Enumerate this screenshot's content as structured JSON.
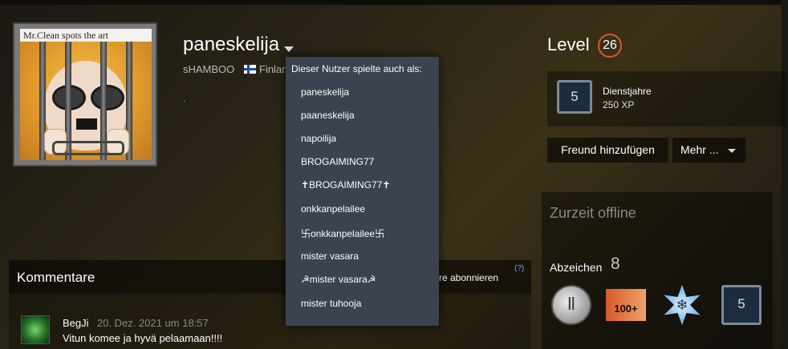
{
  "profile": {
    "avatar_caption": "Mr.Clean spots the art",
    "username": "paneskelija",
    "real_name": "sHAMBOO",
    "country": "Finlan",
    "summary": "."
  },
  "level": {
    "label": "Level",
    "value": "26"
  },
  "years_badge": {
    "icon_number": "5",
    "title": "Dienstjahre",
    "xp": "250 XP"
  },
  "actions": {
    "add_friend": "Freund hinzufügen",
    "more": "Mehr ..."
  },
  "status": {
    "text": "Zurzeit offline"
  },
  "badges": {
    "label": "Abzeichen",
    "count": "8",
    "items": [
      {
        "name": "coin-badge-icon",
        "glyph": "Ⅱ"
      },
      {
        "name": "100-plus-badge-icon",
        "glyph": "100+"
      },
      {
        "name": "snowflake-badge-icon",
        "glyph": "❄"
      },
      {
        "name": "years-of-service-badge-icon",
        "glyph": "5"
      }
    ]
  },
  "comments": {
    "title": "Kommentare",
    "subscribe_label": "tare abonnieren",
    "help": "(?)",
    "items": [
      {
        "author": "BegJi",
        "time": "20. Dez. 2021 um 18:57",
        "text": "Vitun komee ja hyvä pelaamaan!!!!"
      }
    ]
  },
  "alias_menu": {
    "header": "Dieser Nutzer spielte auch als:",
    "items": [
      "paneskelija",
      "paaneskelija",
      "napoilija",
      "BROGAIMING77",
      "✝BROGAIMING77✝",
      "onkkanpelailee",
      "卐onkkanpelailee卐",
      "mister vasara",
      "☭mister vasara☭",
      "mister tuhooja"
    ]
  },
  "colors": {
    "level_ring": "#e0533a",
    "dropdown_bg": "#3b4250",
    "help_link": "#66a8ff"
  }
}
